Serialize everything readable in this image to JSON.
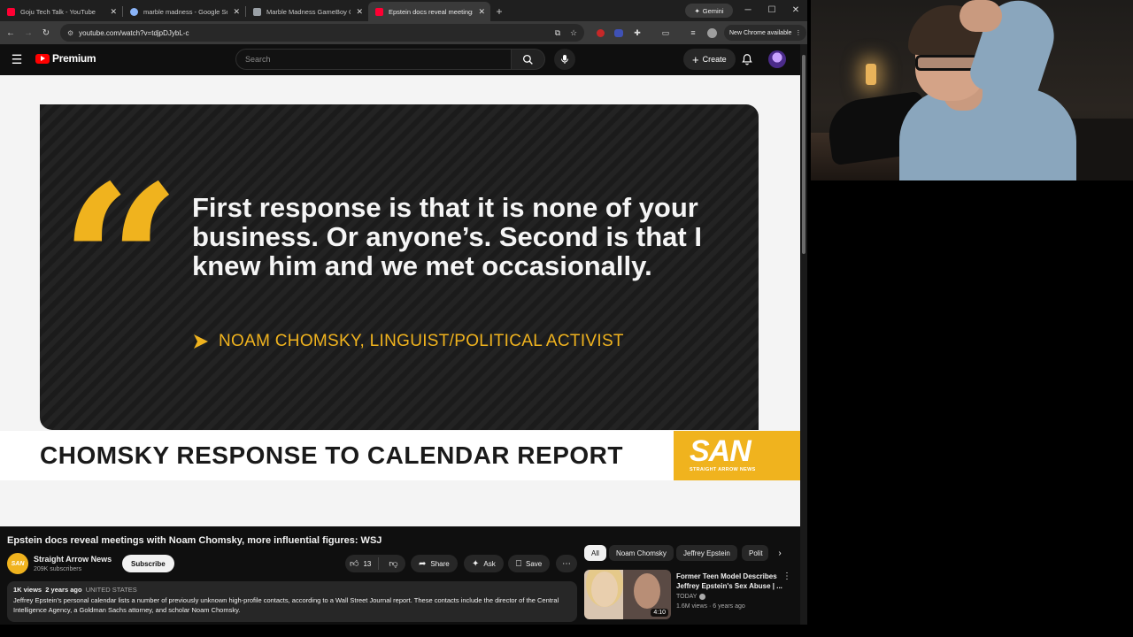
{
  "browser": {
    "tabs": [
      {
        "title": "Goju Tech Talk - YouTube",
        "favicon_color": "#ff0033",
        "active": false
      },
      {
        "title": "marble madness - Google Sear",
        "favicon_color": "#8ab4f8",
        "active": false
      },
      {
        "title": "Marble Madness GameBoy Colo",
        "favicon_color": "#9aa0a6",
        "active": false
      },
      {
        "title": "Epstein docs reveal meetings w",
        "favicon_color": "#ff0033",
        "active": true
      }
    ],
    "gemini_label": "Gemini",
    "url": "youtube.com/watch?v=tdjpDJybL-c",
    "new_chrome_label": "New Chrome available"
  },
  "youtube": {
    "logo_label": "Premium",
    "search_placeholder": "Search",
    "create_label": "Create"
  },
  "video_frame": {
    "quote": "First response is that it is none of your business. Or anyone’s. Second is that I knew him and we met occasionally.",
    "attribution": "NOAM CHOMSKY, LINGUIST/POLITICAL ACTIVIST",
    "headline": "CHOMSKY RESPONSE TO CALENDAR REPORT",
    "brand_big": "SAN",
    "brand_small": "STRAIGHT ARROW NEWS"
  },
  "video": {
    "title": "Epstein docs reveal meetings with Noam Chomsky, more influential figures: WSJ",
    "channel": "Straight Arrow News",
    "channel_avatar_text": "SAN",
    "subscribers": "209K subscribers",
    "subscribe_label": "Subscribe",
    "likes": "13",
    "share_label": "Share",
    "ask_label": "Ask",
    "save_label": "Save",
    "views": "1K views",
    "age": "2 years ago",
    "country": "UNITED STATES",
    "description": "Jeffrey Epstein's personal calendar lists a number of previously unknown high-profile contacts, according to a Wall Street Journal report. These contacts include the director of the Central Intelligence Agency, a Goldman Sachs attorney, and scholar Noam Chomsky."
  },
  "sidebar": {
    "chips": [
      "All",
      "Noam Chomsky",
      "Jeffrey Epstein",
      "Polit"
    ],
    "recommendation": {
      "title": "Former Teen Model Describes Jeffrey Epstein's Sex Abuse | ...",
      "channel": "TODAY",
      "meta": "1.6M views · 6 years ago",
      "duration": "4:10"
    }
  },
  "colors": {
    "accent_yellow": "#f0b31e",
    "youtube_red": "#ff0000",
    "page_bg": "#0f0f0f"
  }
}
